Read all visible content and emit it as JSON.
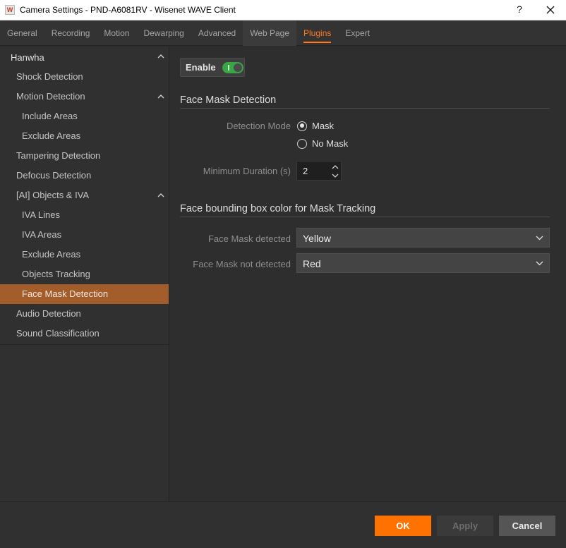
{
  "window": {
    "app_icon_letter": "W",
    "title": "Camera Settings - PND-A6081RV - Wisenet WAVE Client",
    "help_label": "?",
    "close_icon": "close-icon"
  },
  "tabs": [
    {
      "label": "General"
    },
    {
      "label": "Recording"
    },
    {
      "label": "Motion"
    },
    {
      "label": "Dewarping"
    },
    {
      "label": "Advanced"
    },
    {
      "label": "Web Page"
    },
    {
      "label": "Plugins"
    },
    {
      "label": "Expert"
    }
  ],
  "active_tab": "Plugins",
  "sidebar": {
    "items": [
      {
        "label": "Hanwha",
        "level": 0,
        "expanded": true
      },
      {
        "label": "Shock Detection",
        "level": 1
      },
      {
        "label": "Motion Detection",
        "level": 1,
        "expanded": true
      },
      {
        "label": "Include Areas",
        "level": 2
      },
      {
        "label": "Exclude Areas",
        "level": 2
      },
      {
        "label": "Tampering Detection",
        "level": 1
      },
      {
        "label": "Defocus Detection",
        "level": 1
      },
      {
        "label": "[AI] Objects & IVA",
        "level": 1,
        "expanded": true
      },
      {
        "label": "IVA Lines",
        "level": 2
      },
      {
        "label": "IVA Areas",
        "level": 2
      },
      {
        "label": "Exclude Areas",
        "level": 2
      },
      {
        "label": "Objects Tracking",
        "level": 2
      },
      {
        "label": "Face Mask Detection",
        "level": 2,
        "selected": true
      },
      {
        "label": "Audio Detection",
        "level": 1
      },
      {
        "label": "Sound Classification",
        "level": 1
      }
    ]
  },
  "content": {
    "enable_label": "Enable",
    "enabled": true,
    "section1_title": "Face Mask Detection",
    "detection_mode_label": "Detection Mode",
    "detection_mode_options": [
      "Mask",
      "No Mask"
    ],
    "detection_mode_selected": "Mask",
    "min_duration_label": "Minimum Duration (s)",
    "min_duration_value": "2",
    "section2_title": "Face bounding box color for Mask Tracking",
    "mask_detected_label": "Face Mask detected",
    "mask_detected_value": "Yellow",
    "mask_not_detected_label": "Face Mask not detected",
    "mask_not_detected_value": "Red"
  },
  "buttons": {
    "ok": "OK",
    "apply": "Apply",
    "cancel": "Cancel"
  },
  "colors": {
    "accent": "#ff7200",
    "selected_row": "#a35d2b",
    "toggle_on": "#3aa545"
  }
}
